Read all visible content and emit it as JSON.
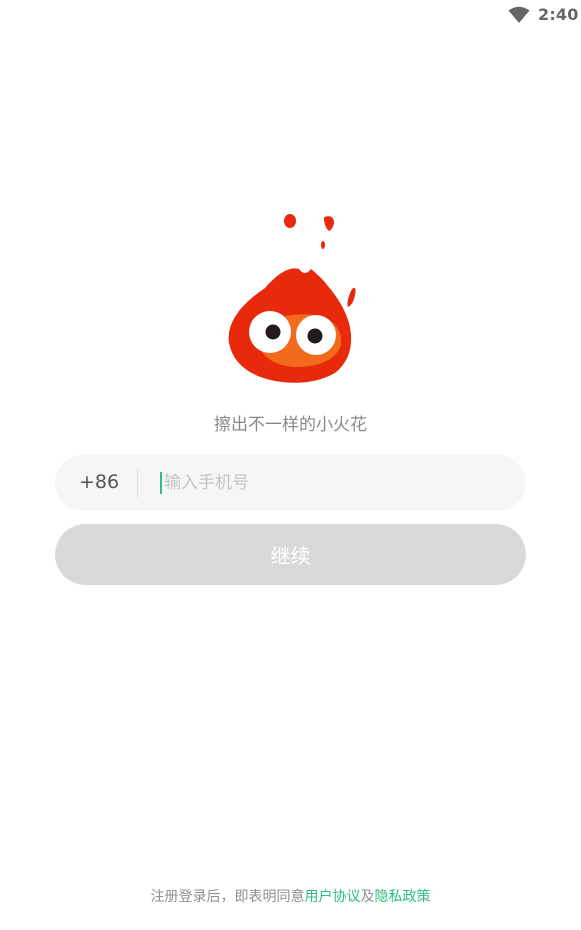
{
  "status_bar": {
    "time": "2:40",
    "wifi_icon": "wifi-icon"
  },
  "logo": {
    "icon": "fire-mascot-icon"
  },
  "tagline": "擦出不一样的小火花",
  "phone": {
    "country_code": "+86",
    "placeholder": "输入手机号",
    "value": ""
  },
  "continue_label": "继续",
  "agreement": {
    "prefix": "注册登录后，即表明同意",
    "user_agreement": "用户协议",
    "conjunction": "及",
    "privacy_policy": "隐私政策"
  },
  "colors": {
    "accent_link": "#2bbf7a",
    "button_disabled": "#d7dad9",
    "mascot_red": "#e8290b",
    "mascot_orange": "#f26a1b"
  }
}
